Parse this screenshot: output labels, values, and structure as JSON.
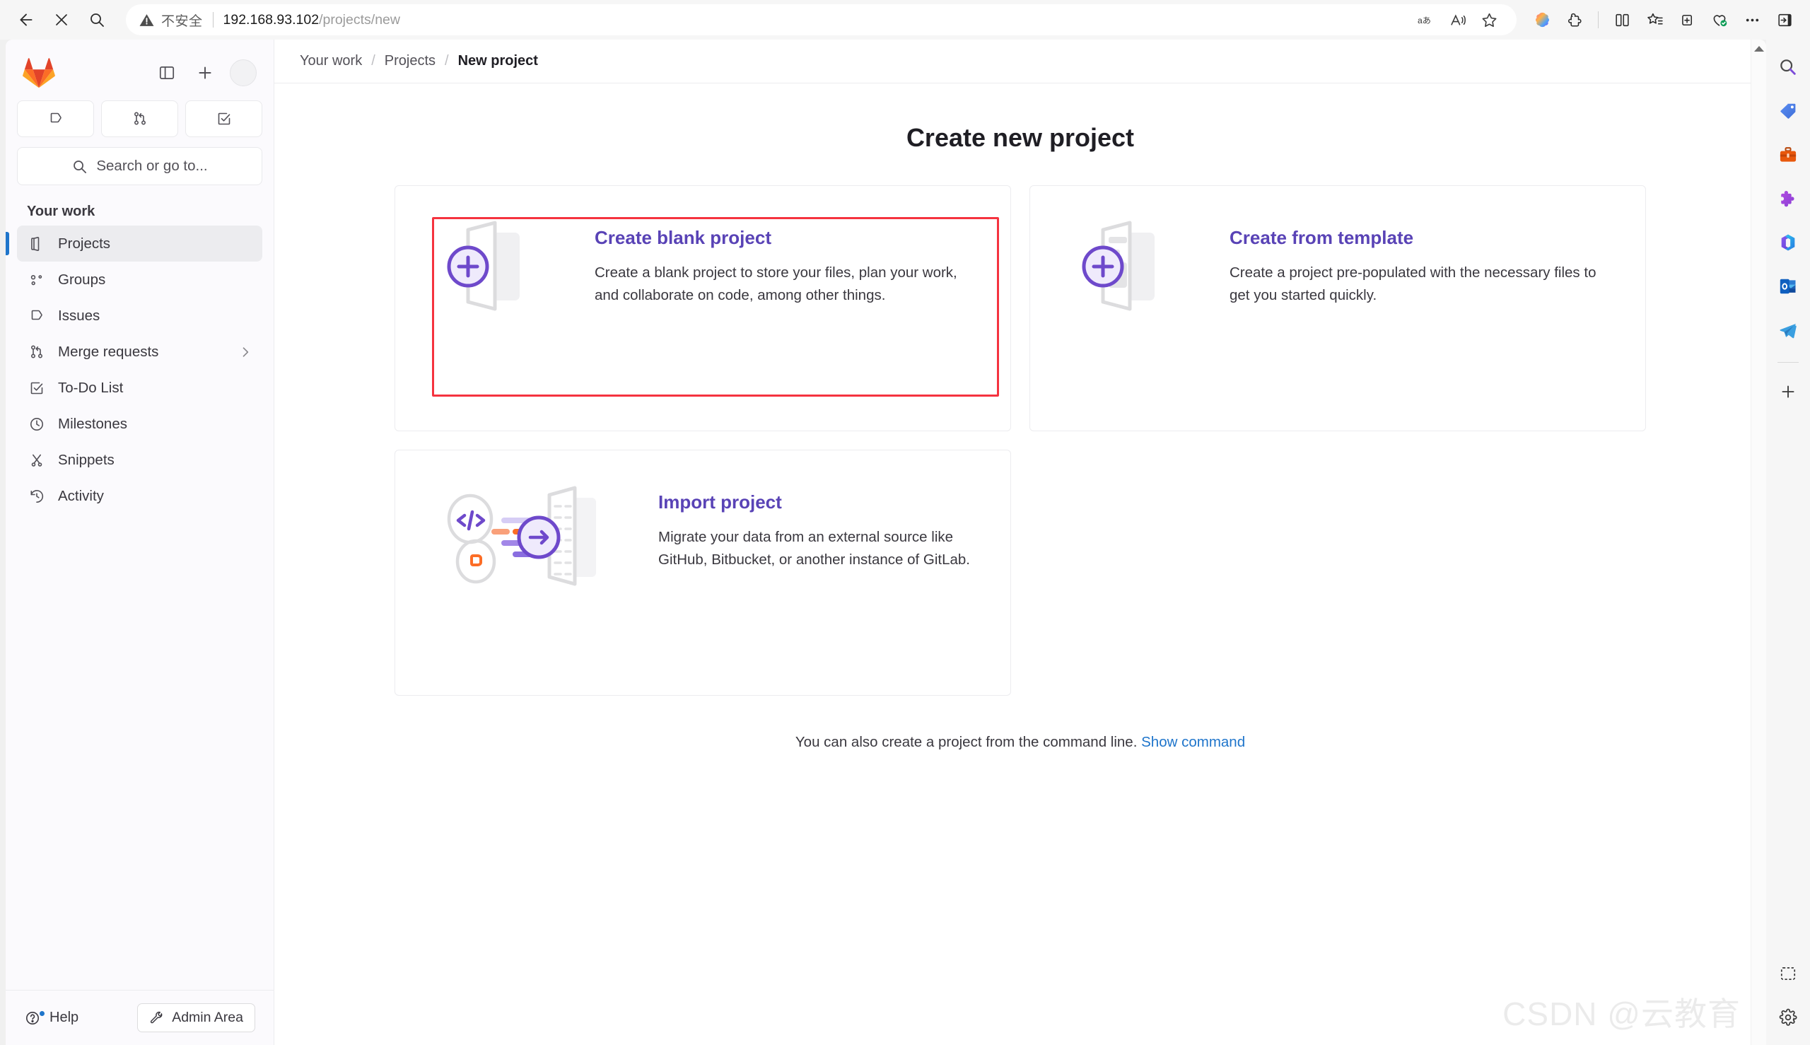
{
  "browser": {
    "back_label": "Back",
    "stop_label": "Stop",
    "search_label": "Search",
    "security_text": "不安全",
    "url_host": "192.168.93.102",
    "url_path": "/projects/new",
    "omni_actions": [
      {
        "name": "translate-icon",
        "label": "aあ"
      },
      {
        "name": "read-aloud-icon",
        "label": "A"
      },
      {
        "name": "favorite-star-icon",
        "label": "☆"
      }
    ],
    "toolbar_actions": [
      {
        "name": "copilot-icon",
        "label": "Copilot"
      },
      {
        "name": "extensions-icon",
        "label": "Extensions"
      },
      {
        "name": "split-screen-icon",
        "label": "Split screen"
      },
      {
        "name": "favorites-icon",
        "label": "Favorites"
      },
      {
        "name": "collections-icon",
        "label": "Collections"
      },
      {
        "name": "browser-essentials-icon",
        "label": "Browser essentials"
      },
      {
        "name": "settings-more-icon",
        "label": "Settings and more"
      },
      {
        "name": "sidebar-toggle-icon",
        "label": "Sidebar"
      }
    ]
  },
  "sidebar": {
    "brand": "GitLab",
    "toggle_label": "Primary navigation sidebar",
    "create_label": "Create new",
    "avatar_label": "User menu",
    "quick_actions": [
      {
        "name": "issues-quick-icon",
        "label": "Issues"
      },
      {
        "name": "merge-requests-quick-icon",
        "label": "Merge requests"
      },
      {
        "name": "todo-quick-icon",
        "label": "To-Do List"
      }
    ],
    "search_placeholder": "Search or go to...",
    "nav_heading": "Your work",
    "items": [
      {
        "label": "Projects",
        "icon": "project-icon",
        "active": true,
        "chevron": false
      },
      {
        "label": "Groups",
        "icon": "group-icon",
        "active": false,
        "chevron": false
      },
      {
        "label": "Issues",
        "icon": "issues-icon",
        "active": false,
        "chevron": false
      },
      {
        "label": "Merge requests",
        "icon": "merge-request-icon",
        "active": false,
        "chevron": true
      },
      {
        "label": "To-Do List",
        "icon": "todo-icon",
        "active": false,
        "chevron": false
      },
      {
        "label": "Milestones",
        "icon": "clock-icon",
        "active": false,
        "chevron": false
      },
      {
        "label": "Snippets",
        "icon": "snippet-icon",
        "active": false,
        "chevron": false
      },
      {
        "label": "Activity",
        "icon": "history-icon",
        "active": false,
        "chevron": false
      }
    ],
    "help_label": "Help",
    "admin_label": "Admin Area"
  },
  "breadcrumb": {
    "item1": "Your work",
    "sep1": "/",
    "item2": "Projects",
    "sep2": "/",
    "current": "New project"
  },
  "main": {
    "title": "Create new project",
    "cards": [
      {
        "id": "create-blank-project",
        "title": "Create blank project",
        "desc": "Create a blank project to store your files, plan your work, and collaborate on code, among other things.",
        "highlighted": true
      },
      {
        "id": "create-from-template",
        "title": "Create from template",
        "desc": "Create a project pre-populated with the necessary files to get you started quickly.",
        "highlighted": false
      },
      {
        "id": "import-project",
        "title": "Import project",
        "desc": "Migrate your data from an external source like GitHub, Bitbucket, or another instance of GitLab.",
        "highlighted": false
      }
    ],
    "cmdline_text": "You can also create a project from the command line.",
    "cmdline_link": "Show command"
  },
  "edge_sidebar": {
    "items": [
      {
        "name": "search-icon",
        "label": "Search"
      },
      {
        "name": "shopping-tag-icon",
        "label": "Shopping"
      },
      {
        "name": "tools-icon",
        "label": "Tools"
      },
      {
        "name": "games-icon",
        "label": "Games"
      },
      {
        "name": "microsoft365-icon",
        "label": "Microsoft 365"
      },
      {
        "name": "outlook-icon",
        "label": "Outlook"
      },
      {
        "name": "telegram-icon",
        "label": "Telegram"
      }
    ],
    "add_label": "Customize",
    "bottom_items": [
      {
        "name": "screenshot-icon",
        "label": "Screenshot"
      },
      {
        "name": "settings-gear-icon",
        "label": "Settings"
      }
    ]
  },
  "watermark": {
    "text": "CSDN @云教育"
  },
  "colors": {
    "accent_purple": "#5943b6",
    "link_blue": "#1f75cb",
    "highlight_red": "#f5333f",
    "active_indicator": "#1f75cb"
  }
}
